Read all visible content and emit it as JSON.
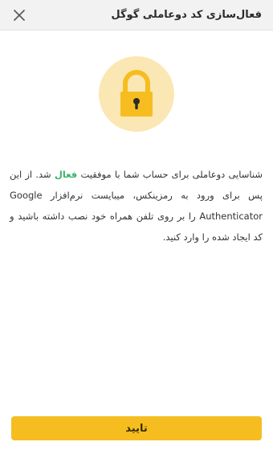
{
  "header": {
    "title": "فعال‌سازی کد دوعاملی گوگل",
    "close_icon": "close-icon"
  },
  "illustration": {
    "icon": "padlock-icon",
    "circle_color": "#fbe7b3",
    "lock_color": "#f5bd1f"
  },
  "message": {
    "part1": "شناسایی دوعاملی برای حساب شما با موفقیت ",
    "status_word": "فعال",
    "part2": " شد. از این پس برای ورود به رمزینکس، میبایست نرم‌افزار Google Authenticator را بر روی تلفن همراه خود نصب داشته باشید و کد ایجاد شده را وارد کنید.",
    "status_color": "#3bb36b"
  },
  "confirm_button": {
    "label": "تایید",
    "color": "#f5bd1f"
  }
}
